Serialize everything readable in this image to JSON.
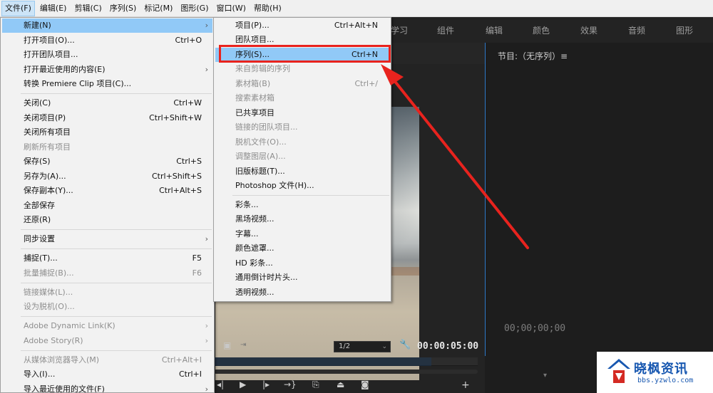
{
  "menubar": {
    "items": [
      "文件(F)",
      "编辑(E)",
      "剪辑(C)",
      "序列(S)",
      "标记(M)",
      "图形(G)",
      "窗口(W)",
      "帮助(H)"
    ]
  },
  "workspace": {
    "tabs": [
      "学习",
      "组件",
      "编辑",
      "颜色",
      "效果",
      "音频",
      "图形"
    ]
  },
  "file_menu": {
    "new": {
      "label": "新建(N)",
      "arrow": "›"
    },
    "open_project": {
      "label": "打开项目(O)...",
      "shortcut": "Ctrl+O"
    },
    "open_team_project": {
      "label": "打开团队项目..."
    },
    "open_recent": {
      "label": "打开最近使用的内容(E)",
      "arrow": "›"
    },
    "convert_clip": {
      "label": "转换 Premiere Clip 项目(C)..."
    },
    "close": {
      "label": "关闭(C)",
      "shortcut": "Ctrl+W"
    },
    "close_project": {
      "label": "关闭项目(P)",
      "shortcut": "Ctrl+Shift+W"
    },
    "close_all": {
      "label": "关闭所有项目"
    },
    "refresh_all": {
      "label": "刷新所有项目"
    },
    "save": {
      "label": "保存(S)",
      "shortcut": "Ctrl+S"
    },
    "save_as": {
      "label": "另存为(A)...",
      "shortcut": "Ctrl+Shift+S"
    },
    "save_copy": {
      "label": "保存副本(Y)...",
      "shortcut": "Ctrl+Alt+S"
    },
    "save_all": {
      "label": "全部保存"
    },
    "revert": {
      "label": "还原(R)"
    },
    "sync_settings": {
      "label": "同步设置",
      "arrow": "›"
    },
    "capture": {
      "label": "捕捉(T)...",
      "shortcut": "F5"
    },
    "batch_capture": {
      "label": "批量捕捉(B)...",
      "shortcut": "F6"
    },
    "link_media": {
      "label": "链接媒体(L)..."
    },
    "make_offline": {
      "label": "设为脱机(O)..."
    },
    "dynamic_link": {
      "label": "Adobe Dynamic Link(K)",
      "arrow": "›"
    },
    "adobe_story": {
      "label": "Adobe Story(R)",
      "arrow": "›"
    },
    "import_from_browser": {
      "label": "从媒体浏览器导入(M)",
      "shortcut": "Ctrl+Alt+I"
    },
    "import": {
      "label": "导入(I)...",
      "shortcut": "Ctrl+I"
    },
    "import_recent": {
      "label": "导入最近使用的文件(F)",
      "arrow": "›"
    }
  },
  "new_submenu": {
    "project": {
      "label": "项目(P)...",
      "shortcut": "Ctrl+Alt+N"
    },
    "team_project": {
      "label": "团队项目..."
    },
    "sequence": {
      "label": "序列(S)...",
      "shortcut": "Ctrl+N"
    },
    "sequence_from_clip": {
      "label": "来自剪辑的序列"
    },
    "bin": {
      "label": "素材箱(B)",
      "shortcut": "Ctrl+/"
    },
    "search_bin": {
      "label": "搜索素材箱"
    },
    "shared_project": {
      "label": "已共享项目"
    },
    "linked_team_project": {
      "label": "链接的团队项目..."
    },
    "offline_file": {
      "label": "脱机文件(O)..."
    },
    "adjustment_layer": {
      "label": "调整图层(A)..."
    },
    "legacy_title": {
      "label": "旧版标题(T)..."
    },
    "photoshop_file": {
      "label": "Photoshop 文件(H)..."
    },
    "bars_tone": {
      "label": "彩条..."
    },
    "black_video": {
      "label": "黑场视频..."
    },
    "captions": {
      "label": "字幕..."
    },
    "color_matte": {
      "label": "颜色遮罩..."
    },
    "hd_bars": {
      "label": "HD 彩条..."
    },
    "countdown": {
      "label": "通用倒计时片头..."
    },
    "transparent_video": {
      "label": "透明视频..."
    }
  },
  "source_panel": {
    "zoom": "1/2",
    "duration": "00:00:05:00"
  },
  "program_panel": {
    "title": "节目:（无序列）≡",
    "timecode": "00;00;00;00"
  },
  "watermark": {
    "brand": "晓枫资讯",
    "url": "bbs.yzwlo.com"
  },
  "colors": {
    "menu_highlight": "#91c9f7",
    "annotation_red": "#e8231e",
    "panel_bg": "#232323",
    "accent_blue": "#2d78c8"
  }
}
